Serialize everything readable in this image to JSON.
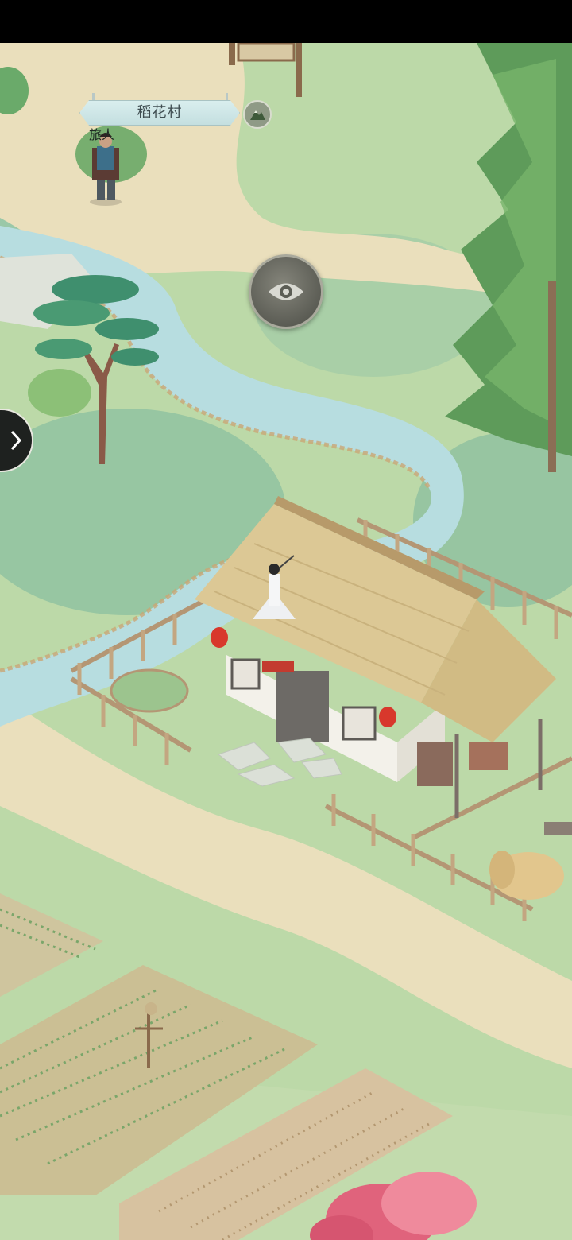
{
  "location": {
    "name": "稻花村"
  },
  "npc": {
    "name": "旅人"
  },
  "icons": {
    "map_toggle": "mountain-icon",
    "view": "eye-icon",
    "side_expand": "chevron-right-icon"
  },
  "colors": {
    "status_bar": "#000000",
    "grass": "#bcd9a8",
    "river": "#b7dde0",
    "path": "#eadfbc",
    "banner": "#d4eaea"
  }
}
